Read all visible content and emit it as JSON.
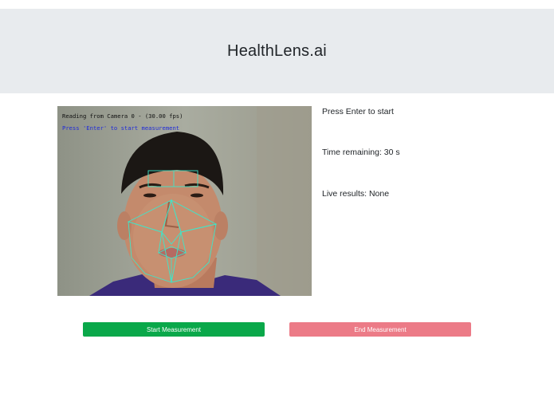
{
  "header": {
    "title": "HealthLens.ai"
  },
  "camera": {
    "overlay_status": "Reading from Camera 0 - (30.00 fps)",
    "overlay_prompt": "Press 'Enter' to start measurement"
  },
  "status": {
    "prompt": "Press Enter to start",
    "time_remaining": "Time remaining: 30 s",
    "live_results": "Live results: None"
  },
  "buttons": {
    "start_label": "Start Measurement",
    "end_label": "End Measurement"
  },
  "colors": {
    "header_bg": "#e8ebee",
    "start_button": "#0aa84a",
    "end_button": "#ec7b87",
    "landmark_lines": "#3ee6c9",
    "overlay_prompt": "#1f2bd8"
  }
}
